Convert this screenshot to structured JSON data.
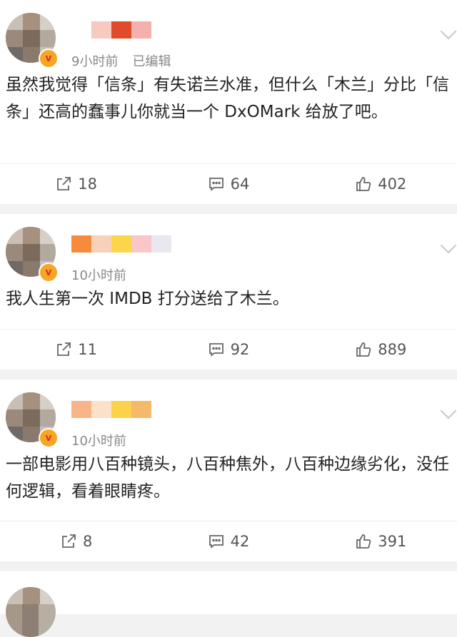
{
  "posts": [
    {
      "time": "9小时前",
      "edited": "已编辑",
      "name_colors": [
        "#ffffff",
        "#f7c9bf",
        "#e24a2c",
        "#f4b0ad",
        "#ffffff"
      ],
      "text": "虽然我觉得「信条」有失诺兰水准，但什么「木兰」分比「信条」还高的蠢事儿你就当一个 DxOMark 给放了吧。",
      "reposts": "18",
      "comments": "64",
      "likes": "402"
    },
    {
      "time": "10小时前",
      "edited": "",
      "name_colors": [
        "#f58b3b",
        "#f8d1bb",
        "#fbd64a",
        "#f9c6c9",
        "#e8e8ee"
      ],
      "text": "我人生第一次 IMDB 打分送给了木兰。",
      "reposts": "11",
      "comments": "92",
      "likes": "889"
    },
    {
      "time": "10小时前",
      "edited": "",
      "name_colors": [
        "#f8b58a",
        "#fbe1c9",
        "#fbd24a",
        "#f5b96a",
        "#ffffff"
      ],
      "text": "一部电影用八百种镜头，八百种焦外，八百种边缘劣化，没任何逻辑，看着眼睛疼。",
      "reposts": "8",
      "comments": "42",
      "likes": "391"
    }
  ],
  "icons": {
    "repost": "repost-icon",
    "comment": "comment-icon",
    "like": "like-icon",
    "badge": "verified-badge-icon",
    "menu": "chevron-down-icon"
  }
}
